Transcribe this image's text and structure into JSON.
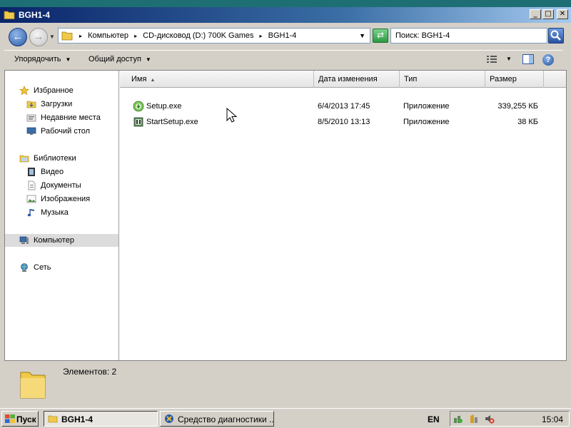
{
  "window": {
    "title": "BGH1-4",
    "buttons": {
      "minimize": "_",
      "maximize": "□",
      "close": "✕"
    }
  },
  "address": {
    "breadcrumbs": [
      "Компьютер",
      "CD-дисковод (D:) 700K Games",
      "BGH1-4"
    ],
    "separator": "▸",
    "search_placeholder": "Поиск: BGH1-4"
  },
  "toolbar": {
    "organize": "Упорядочить",
    "share": "Общий доступ",
    "help": "?"
  },
  "nav": {
    "favorites": {
      "label": "Избранное",
      "items": [
        "Загрузки",
        "Недавние места",
        "Рабочий стол"
      ]
    },
    "libraries": {
      "label": "Библиотеки",
      "items": [
        "Видео",
        "Документы",
        "Изображения",
        "Музыка"
      ]
    },
    "computer": "Компьютер",
    "network": "Сеть"
  },
  "columns": {
    "name": "Имя",
    "date": "Дата изменения",
    "type": "Тип",
    "size": "Размер"
  },
  "files": [
    {
      "name": "Setup.exe",
      "date": "6/4/2013 17:45",
      "type": "Приложение",
      "size": "339,255 КБ",
      "icon": "setup-exe-icon"
    },
    {
      "name": "StartSetup.exe",
      "date": "8/5/2010 13:13",
      "type": "Приложение",
      "size": "38 КБ",
      "icon": "startsetup-exe-icon"
    }
  ],
  "details": {
    "items_count": "Элементов: 2"
  },
  "taskbar": {
    "start": "Пуск",
    "tasks": [
      "BGH1-4",
      "Средство диагностики ..."
    ],
    "language": "EN",
    "clock": "15:04"
  },
  "colors": {
    "desktop": "#1d6f73",
    "titlebar_start": "#0a246a",
    "titlebar_end": "#a6caf0",
    "selection": "#dcdcdc",
    "folder": "#f0c94a"
  }
}
